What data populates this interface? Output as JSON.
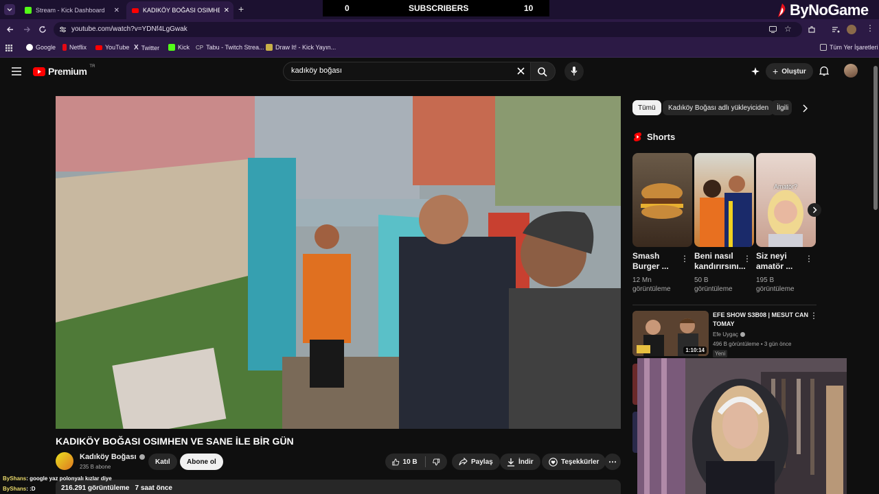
{
  "browser": {
    "tabs": [
      {
        "title": "Stream - Kick Dashboard"
      },
      {
        "title": "KADIKÖY BOĞASI OSIMHEN VE"
      }
    ],
    "url": "youtube.com/watch?v=YDNf4LgGwak",
    "bookmarks": [
      "Google",
      "Netflix",
      "YouTube",
      "Twitter",
      "Kick",
      "Tabu - Twitch Strea...",
      "Draw It! - Kick Yayın..."
    ],
    "all_bookmarks": "Tüm Yer İşaretleri"
  },
  "overlay": {
    "left_count": "0",
    "label": "SUBSCRIBERS",
    "right_count": "10",
    "brand": "ByNoGame"
  },
  "youtube": {
    "logo_text": "Premium",
    "logo_sup": "TR",
    "search_value": "kadıköy boğası",
    "create_label": "Oluştur",
    "video": {
      "title": "KADIKÖY BOĞASI OSIMHEN VE SANE İLE BİR GÜN",
      "channel": "Kadıköy Boğası",
      "subs": "235 B abone",
      "join": "Katıl",
      "subscribe": "Abone ol",
      "likes": "10 B",
      "share": "Paylaş",
      "download": "İndir",
      "thanks": "Teşekkürler",
      "views": "216.291 görüntüleme",
      "time": "7 saat önce"
    },
    "chips": [
      "Tümü",
      "Kadıköy Boğası adlı yükleyiciden",
      "İlgili"
    ],
    "shorts_label": "Shorts",
    "shorts": [
      {
        "title1": "Smash",
        "title2": "Burger ...",
        "views1": "12 Mn",
        "views2": "görüntüleme"
      },
      {
        "title1": "Beni nasıl",
        "title2": "kandırırsını...",
        "views1": "50 B",
        "views2": "görüntüleme"
      },
      {
        "title1": "Siz neyi",
        "title2": "amatör ...",
        "views1": "195 B",
        "views2": "görüntüleme"
      }
    ],
    "short3_overlay": "Amatör?",
    "rec": {
      "title1": "EFE SHOW S3B08 | MESUT CAN",
      "title2": "TOMAY",
      "channel": "Efe Uygaç",
      "meta": "496 B görüntüleme • 3 gün önce",
      "badge": "Yeni",
      "duration": "1:10:14"
    }
  },
  "chat": [
    {
      "user": "ByShans",
      "msg": ": google yaz polonyalı kızlar diye"
    },
    {
      "user": "ByShans",
      "msg": ": :D"
    }
  ],
  "colors": {
    "accent": "#ff0000",
    "kick": "#53fc18",
    "chrome_bg": "#1c1130",
    "toolbar_bg": "#2c1a45"
  }
}
